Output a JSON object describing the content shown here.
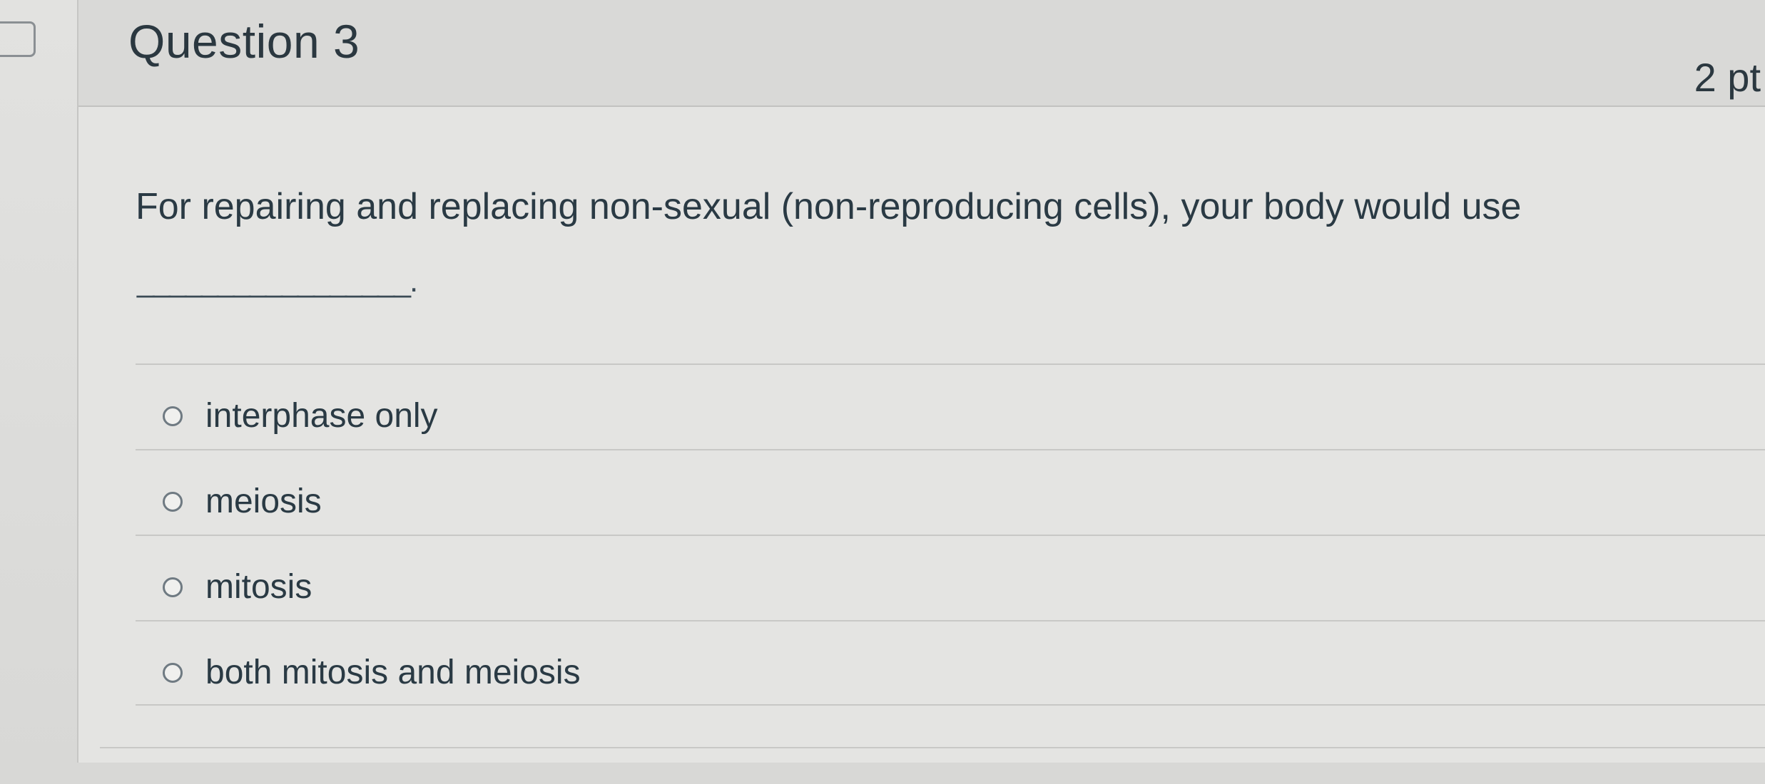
{
  "question": {
    "title": "Question 3",
    "points": "2 pt",
    "text": "For repairing and replacing non-sexual (non-reproducing cells), your body would use",
    "blank": "_________________."
  },
  "answers": [
    {
      "label": "interphase only"
    },
    {
      "label": "meiosis"
    },
    {
      "label": "mitosis"
    },
    {
      "label": "both mitosis and meiosis"
    }
  ],
  "icons": {
    "flag": "flag-outline-icon",
    "radio": "radio-unchecked-icon"
  },
  "colors": {
    "text": "#2d3b45",
    "background": "#e4e4e2",
    "header": "#d9d9d7",
    "border": "#c8c8c6"
  }
}
